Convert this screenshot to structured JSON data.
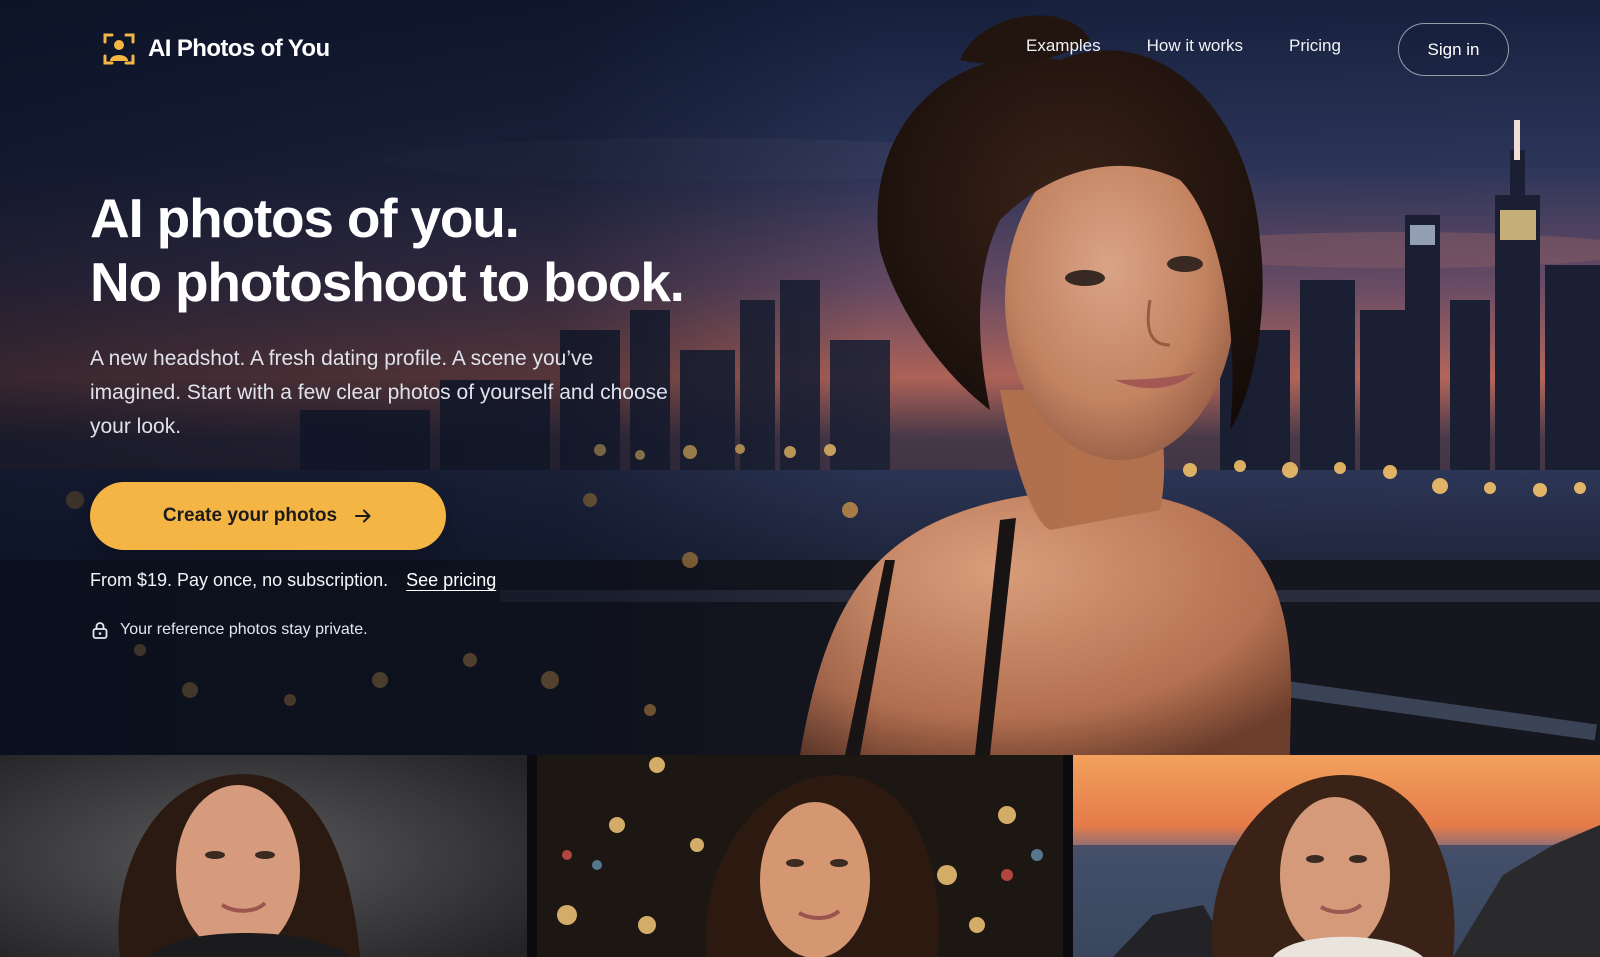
{
  "brand": {
    "name": "AI Photos of You",
    "accent_color": "#f4b545",
    "logo_icon": "portrait-frame-icon"
  },
  "nav": {
    "links": [
      {
        "label": "Examples"
      },
      {
        "label": "How it works"
      },
      {
        "label": "Pricing"
      }
    ],
    "signin_label": "Sign in"
  },
  "hero": {
    "headline_line1": "AI photos of you.",
    "headline_line2": "No photoshoot to book.",
    "subcopy": "A new headshot. A fresh dating profile. A scene you’ve imagined. Start with a few clear photos of yourself and choose your look.",
    "cta_label": "Create your photos",
    "cta_icon": "arrow-right-icon",
    "price_text": "From $19. Pay once, no subscription.",
    "pricing_link_label": "See pricing",
    "privacy_text": "Your reference photos stay private.",
    "privacy_icon": "lock-icon",
    "background": "woman-on-balcony-city-skyline-at-dusk"
  },
  "gallery": [
    {
      "scene": "studio-headshot-dark-backdrop"
    },
    {
      "scene": "city-street-night-bokeh"
    },
    {
      "scene": "seaside-sunset-cliffs"
    }
  ]
}
